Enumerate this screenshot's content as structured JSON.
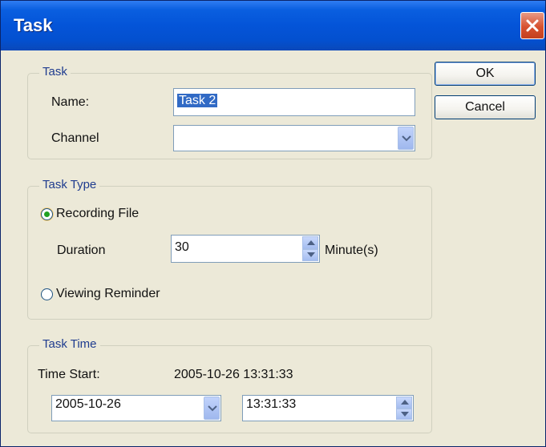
{
  "window": {
    "title": "Task"
  },
  "buttons": {
    "ok": "OK",
    "cancel": "Cancel"
  },
  "task_group": {
    "legend": "Task",
    "name_label": "Name:",
    "name_value": "Task 2",
    "channel_label": "Channel",
    "channel_value": ""
  },
  "type_group": {
    "legend": "Task Type",
    "recording_label": "Recording File",
    "recording_selected": true,
    "duration_label": "Duration",
    "duration_value": "30",
    "duration_unit": "Minute(s)",
    "viewing_label": "Viewing Reminder",
    "viewing_selected": false
  },
  "time_group": {
    "legend": "Task Time",
    "start_label": "Time Start:",
    "start_value": "2005-10-26 13:31:33",
    "date_value": "2005-10-26",
    "time_value": "13:31:33"
  },
  "icons": {
    "close": "close-icon",
    "dropdown": "chevron-down-icon",
    "spin_up": "spin-up-icon",
    "spin_down": "spin-down-icon"
  },
  "colors": {
    "titlebar": "#0454d8",
    "dialog_bg": "#ece9d8",
    "group_legend": "#1f3c8f",
    "close_button": "#d7512f",
    "selection": "#316ac5"
  }
}
